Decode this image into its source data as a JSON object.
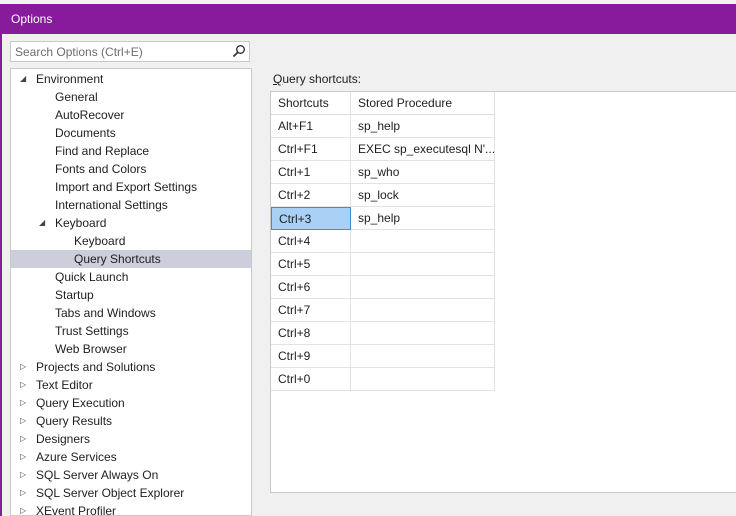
{
  "window": {
    "title": "Options"
  },
  "search": {
    "placeholder": "Search Options (Ctrl+E)"
  },
  "tree": [
    {
      "label": "Environment",
      "level": 0,
      "expander": "expanded"
    },
    {
      "label": "General",
      "level": 1
    },
    {
      "label": "AutoRecover",
      "level": 1
    },
    {
      "label": "Documents",
      "level": 1
    },
    {
      "label": "Find and Replace",
      "level": 1
    },
    {
      "label": "Fonts and Colors",
      "level": 1
    },
    {
      "label": "Import and Export Settings",
      "level": 1
    },
    {
      "label": "International Settings",
      "level": 1
    },
    {
      "label": "Keyboard",
      "level": 1,
      "expander": "expanded"
    },
    {
      "label": "Keyboard",
      "level": 2
    },
    {
      "label": "Query Shortcuts",
      "level": 2,
      "selected": true
    },
    {
      "label": "Quick Launch",
      "level": 1
    },
    {
      "label": "Startup",
      "level": 1
    },
    {
      "label": "Tabs and Windows",
      "level": 1
    },
    {
      "label": "Trust Settings",
      "level": 1
    },
    {
      "label": "Web Browser",
      "level": 1
    },
    {
      "label": "Projects and Solutions",
      "level": 0,
      "expander": "collapsed"
    },
    {
      "label": "Text Editor",
      "level": 0,
      "expander": "collapsed"
    },
    {
      "label": "Query Execution",
      "level": 0,
      "expander": "collapsed"
    },
    {
      "label": "Query Results",
      "level": 0,
      "expander": "collapsed"
    },
    {
      "label": "Designers",
      "level": 0,
      "expander": "collapsed"
    },
    {
      "label": "Azure Services",
      "level": 0,
      "expander": "collapsed"
    },
    {
      "label": "SQL Server Always On",
      "level": 0,
      "expander": "collapsed"
    },
    {
      "label": "SQL Server Object Explorer",
      "level": 0,
      "expander": "collapsed"
    },
    {
      "label": "XEvent Profiler",
      "level": 0,
      "expander": "collapsed"
    }
  ],
  "query_shortcuts": {
    "label_accel": "Q",
    "label_rest": "uery shortcuts:",
    "columns": [
      "Shortcuts",
      "Stored Procedure"
    ],
    "rows": [
      {
        "shortcut": "Alt+F1",
        "procedure": "sp_help"
      },
      {
        "shortcut": "Ctrl+F1",
        "procedure": "EXEC sp_executesql N'..."
      },
      {
        "shortcut": "Ctrl+1",
        "procedure": "sp_who"
      },
      {
        "shortcut": "Ctrl+2",
        "procedure": "sp_lock"
      },
      {
        "shortcut": "Ctrl+3",
        "procedure": "sp_help",
        "selected": true
      },
      {
        "shortcut": "Ctrl+4",
        "procedure": ""
      },
      {
        "shortcut": "Ctrl+5",
        "procedure": ""
      },
      {
        "shortcut": "Ctrl+6",
        "procedure": ""
      },
      {
        "shortcut": "Ctrl+7",
        "procedure": ""
      },
      {
        "shortcut": "Ctrl+8",
        "procedure": ""
      },
      {
        "shortcut": "Ctrl+9",
        "procedure": ""
      },
      {
        "shortcut": "Ctrl+0",
        "procedure": ""
      }
    ]
  },
  "colors": {
    "title_bar": "#881a9c",
    "tree_selection": "#cccedb",
    "cell_selection": "#a9d1f5"
  }
}
